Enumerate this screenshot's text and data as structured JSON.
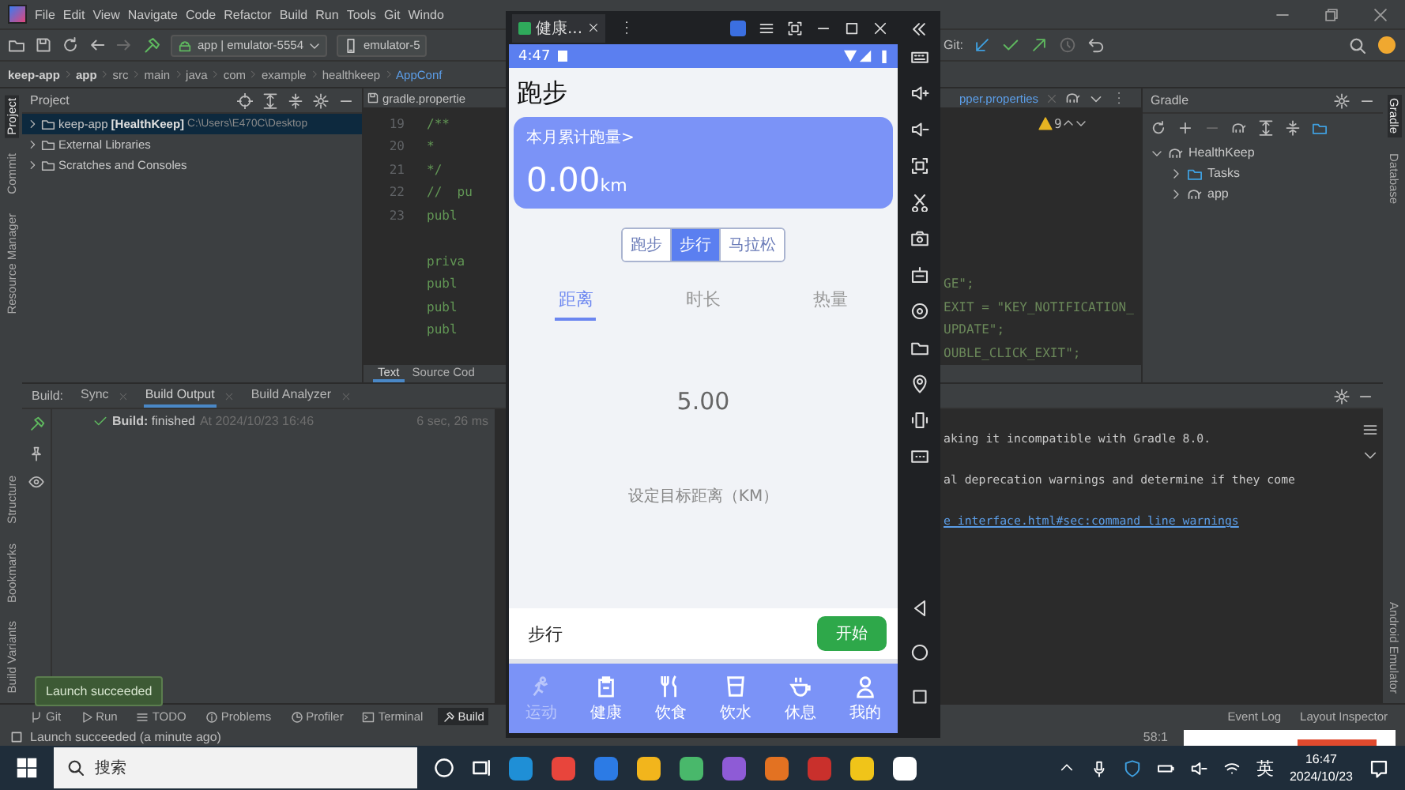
{
  "ide": {
    "menu": [
      "File",
      "Edit",
      "View",
      "Navigate",
      "Code",
      "Refactor",
      "Build",
      "Run",
      "Tools",
      "Git",
      "Windo"
    ],
    "run_config": "app | emulator-5554",
    "device": "emulator-5",
    "git_label": "Git:",
    "breadcrumb": [
      "keep-app",
      "app",
      "src",
      "main",
      "java",
      "com",
      "example",
      "healthkeep",
      "AppConf"
    ],
    "left_tools_top": [
      {
        "label": "Project",
        "selected": true
      },
      {
        "label": "Commit",
        "selected": false
      },
      {
        "label": "Resource Manager",
        "selected": false
      }
    ],
    "left_tools_bottom": [
      "Structure",
      "Bookmarks",
      "Build Variants"
    ],
    "project": {
      "title": "Project",
      "tree": [
        {
          "label": "keep-app",
          "module": "[HealthKeep]",
          "path": "C:\\Users\\E470C\\Desktop",
          "expanded": false,
          "selected": true
        },
        {
          "label": "External Libraries",
          "expanded": false,
          "selected": false
        },
        {
          "label": "Scratches and Consoles",
          "expanded": false,
          "selected": false
        }
      ]
    },
    "editor_tabs": [
      {
        "label": "gradle.propertie"
      },
      {
        "label": "pper.properties"
      }
    ],
    "warning_count": "9",
    "code_lines": [
      {
        "number": "19",
        "left": "/**"
      },
      {
        "number": "20",
        "left": "*"
      },
      {
        "number": "21",
        "left": "*/"
      },
      {
        "number": "22",
        "left": "//  pu"
      },
      {
        "number": "23",
        "left": "publ"
      },
      {
        "left": "priva",
        "blank_before": true
      },
      {
        "left": "publ",
        "right": "GE\";"
      },
      {
        "left": "publ",
        "right": "EXIT = \"KEY_NOTIFICATION_"
      },
      {
        "left": "publ",
        "right": "UPDATE\";"
      },
      {
        "right": "OUBLE_CLICK_EXIT\";"
      }
    ],
    "editor_modes": [
      {
        "label": "Text",
        "selected": true
      },
      {
        "label": "Source Cod",
        "selected": false
      }
    ],
    "gradle": {
      "title": "Gradle",
      "tree": [
        {
          "label": "HealthKeep",
          "expanded": true,
          "children": [
            {
              "label": "Tasks",
              "kind": "folder",
              "expanded": false
            },
            {
              "label": "app",
              "kind": "module",
              "expanded": false
            }
          ]
        }
      ]
    },
    "right_tools_top": [
      {
        "label": "Gradle",
        "selected": true
      },
      {
        "label": "Database",
        "selected": false
      }
    ],
    "right_tools_bottom": [
      "Android Emulator"
    ],
    "build": {
      "title": "Build:",
      "tabs": [
        {
          "label": "Sync",
          "selected": false
        },
        {
          "label": "Build Output",
          "selected": true
        },
        {
          "label": "Build Analyzer",
          "selected": false
        }
      ],
      "result": "**Build:** finished",
      "time": "At 2024/10/23 16:46",
      "duration": "6 sec, 26 ms",
      "console": [
        {
          "kind": "text",
          "text": "aking it incompatible with Gradle 8.0."
        },
        {
          "kind": "text",
          "text": "al deprecation warnings and determine if they come"
        },
        {
          "kind": "link",
          "text": "e_interface.html#sec:command_line_warnings"
        }
      ]
    },
    "tool_windows": [
      {
        "label": "Git",
        "selected": false
      },
      {
        "label": "Run",
        "selected": false
      },
      {
        "label": "TODO",
        "selected": false
      },
      {
        "label": "Problems",
        "selected": false
      },
      {
        "label": "Profiler",
        "selected": false
      },
      {
        "label": "Terminal",
        "selected": false
      },
      {
        "label": "Build",
        "selected": true
      }
    ],
    "right_tool_windows": [
      "Event Log",
      "Layout Inspector"
    ],
    "tooltip": "Launch succeeded",
    "status": "Launch succeeded (a minute ago)",
    "position": "58:1"
  },
  "emulator": {
    "tab": "健康...",
    "time": "4:47",
    "title": "跑步",
    "card": {
      "label": "本月累计跑量>",
      "value": "0.00",
      "unit": "km"
    },
    "modes": [
      {
        "label": "跑步",
        "selected": false
      },
      {
        "label": "步行",
        "selected": true
      },
      {
        "label": "马拉松",
        "selected": false
      }
    ],
    "metrics": [
      {
        "label": "距离",
        "selected": true
      },
      {
        "label": "时长",
        "selected": false
      },
      {
        "label": "热量",
        "selected": false
      }
    ],
    "goal": "5.00",
    "goal_label": "设定目标距离（KM）",
    "activity": "步行",
    "start": "开始",
    "nav": [
      {
        "label": "运动",
        "selected": true
      },
      {
        "label": "健康",
        "selected": false
      },
      {
        "label": "饮食",
        "selected": false
      },
      {
        "label": "饮水",
        "selected": false
      },
      {
        "label": "休息",
        "selected": false
      },
      {
        "label": "我的",
        "selected": false
      }
    ]
  },
  "taskbar": {
    "search": "搜索",
    "ime": "英",
    "time": "16:47",
    "date": "2024/10/23"
  }
}
